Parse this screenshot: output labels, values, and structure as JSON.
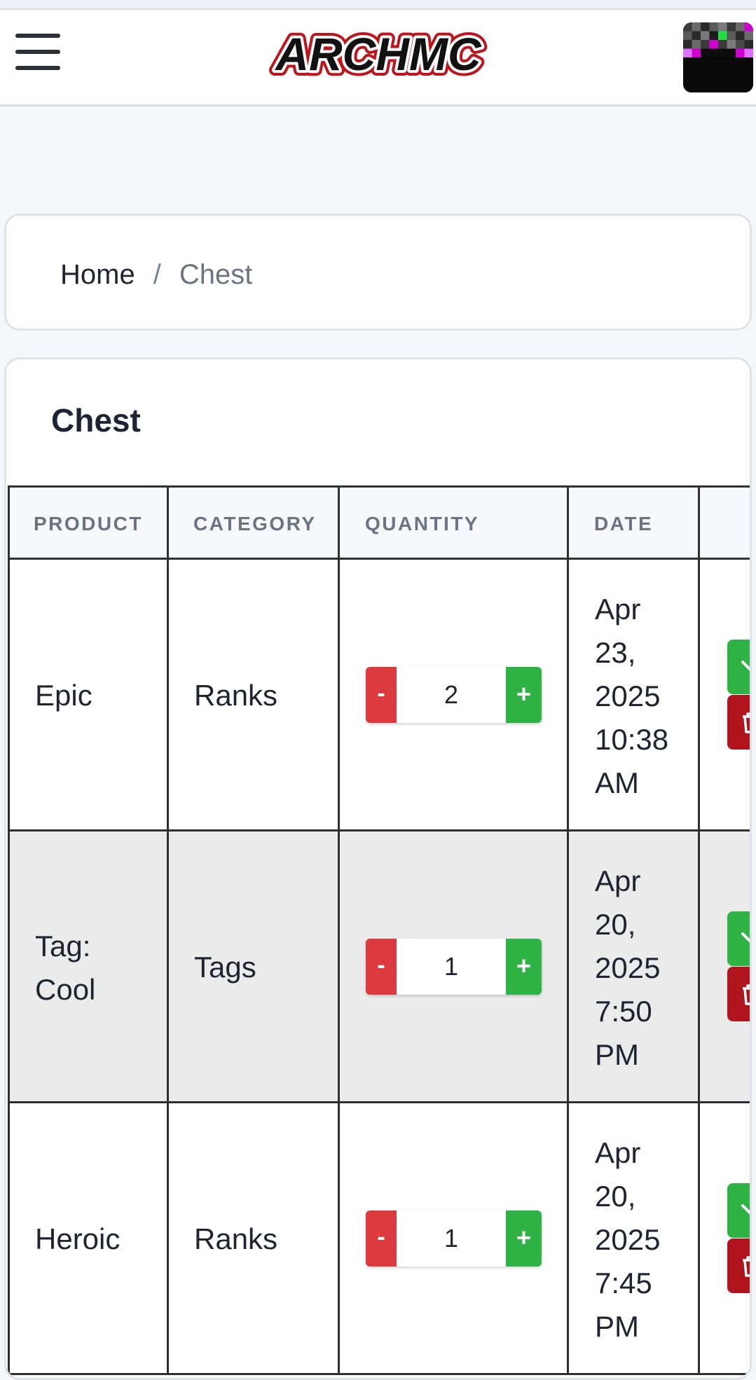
{
  "header": {
    "logo_text": "ARCHMC",
    "menu_icon": "hamburger-icon",
    "avatar_icon": "player-avatar-icon"
  },
  "breadcrumb": {
    "home": "Home",
    "separator": "/",
    "current": "Chest"
  },
  "chest": {
    "title": "Chest",
    "columns": [
      "PRODUCT",
      "CATEGORY",
      "QUANTITY",
      "DATE"
    ],
    "rows": [
      {
        "product_lines": [
          "Epic"
        ],
        "category": "Ranks",
        "quantity": "2",
        "date_lines": [
          "Apr",
          "23,",
          "2025",
          "10:38",
          "AM"
        ]
      },
      {
        "product_lines": [
          "Tag:",
          "Cool"
        ],
        "category": "Tags",
        "quantity": "1",
        "date_lines": [
          "Apr",
          "20,",
          "2025",
          "7:50",
          "PM"
        ]
      },
      {
        "product_lines": [
          "Heroic"
        ],
        "category": "Ranks",
        "quantity": "1",
        "date_lines": [
          "Apr",
          "20,",
          "2025",
          "7:45",
          "PM"
        ]
      }
    ],
    "minus_label": "-",
    "plus_label": "+"
  },
  "colors": {
    "accent_green": "#2fb345",
    "accent_red": "#db3a3f",
    "dark_red": "#b0151e"
  }
}
